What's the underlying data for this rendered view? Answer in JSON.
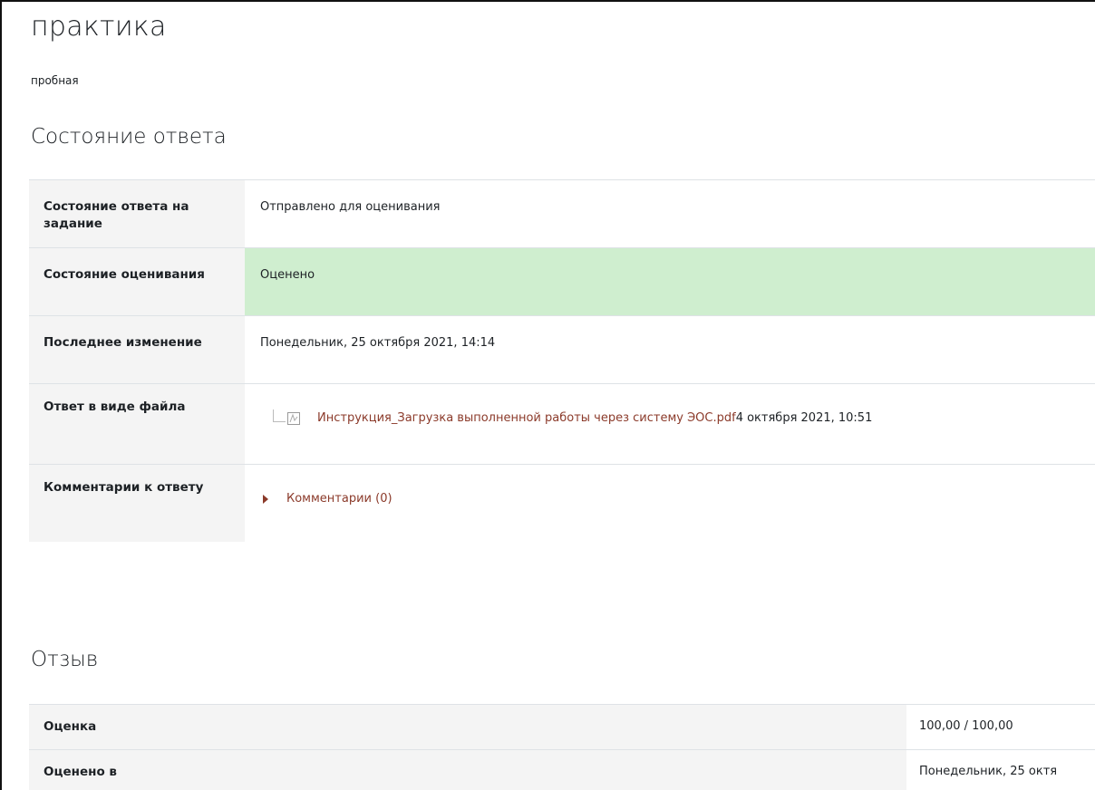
{
  "page": {
    "title": "практика",
    "description": "пробная"
  },
  "submission_status": {
    "heading": "Состояние ответа",
    "rows": [
      {
        "label": "Состояние ответа на задание",
        "value": "Отправлено для оценивания"
      },
      {
        "label": "Состояние оценивания",
        "value": "Оценено"
      },
      {
        "label": "Последнее изменение",
        "value": "Понедельник, 25 октября 2021, 14:14"
      },
      {
        "label": "Ответ в виде файла",
        "file_name": "Инструкция_Загрузка выполненной работы через систему ЭОС.pdf",
        "file_date": "4 октября 2021, 10:51"
      },
      {
        "label": "Комментарии к ответу",
        "comments_link": "Комментарии (0)"
      }
    ]
  },
  "feedback": {
    "heading": "Отзыв",
    "rows": [
      {
        "label": "Оценка",
        "value": "100,00 / 100,00"
      },
      {
        "label": "Оценено в",
        "value": "Понедельник, 25 октя"
      }
    ]
  },
  "colors": {
    "graded_background": "#cfeecf",
    "link": "#8b3a2a",
    "label_background": "#f4f4f4"
  },
  "icons": {
    "file_type": "pdf-icon",
    "expand": "collapsed-triangle-icon"
  }
}
